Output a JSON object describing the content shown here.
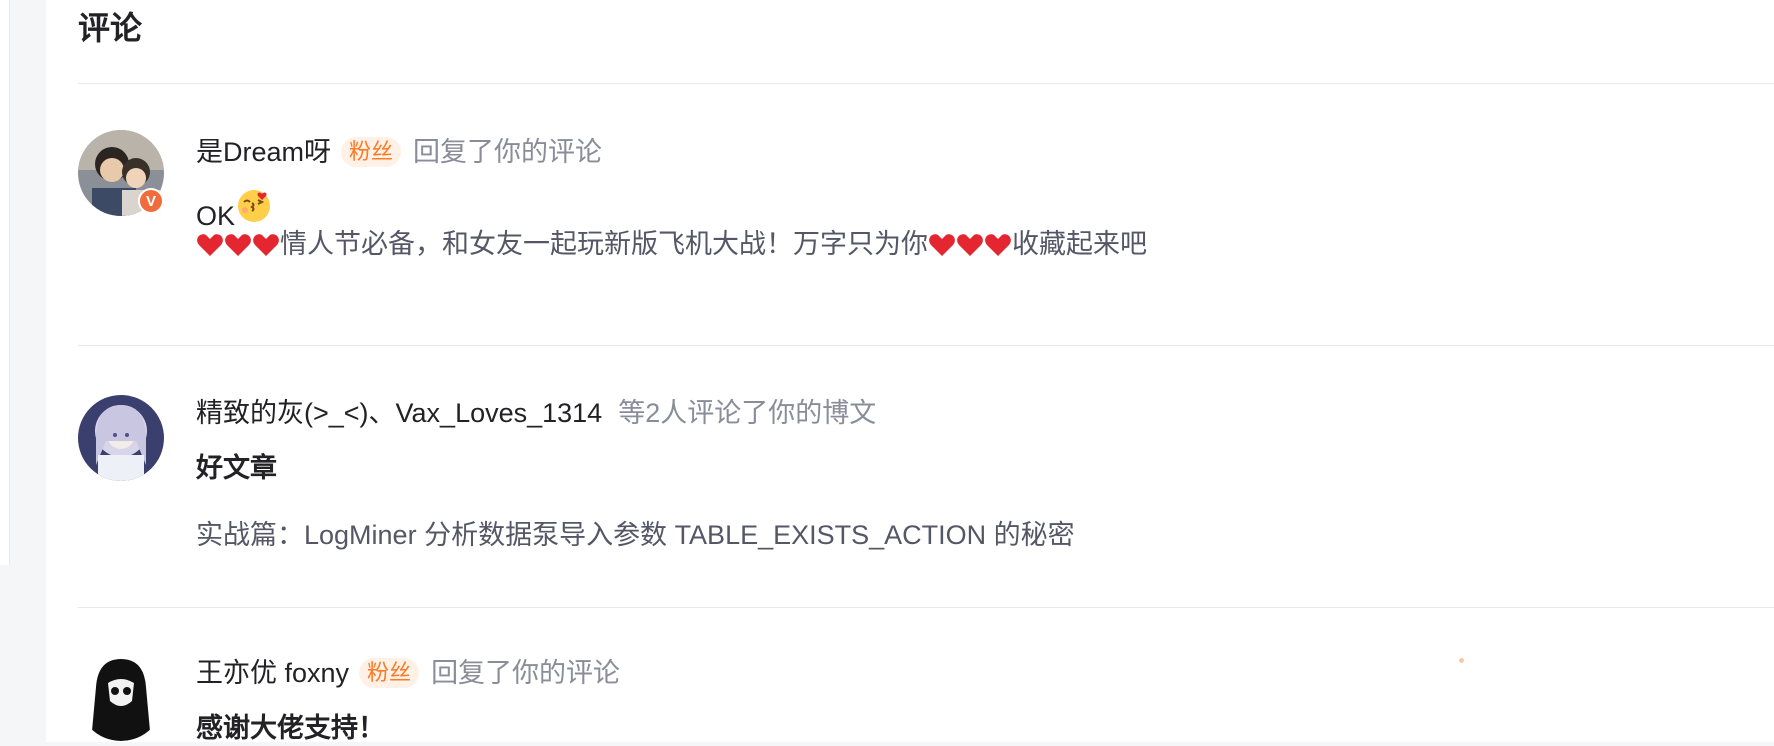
{
  "section": {
    "title": "评论"
  },
  "notifications": [
    {
      "username": "是Dream呀",
      "badge": "粉丝",
      "action": "回复了你的评论",
      "comment": "OK",
      "comment_emoji": "kiss-face-emoji",
      "article_title": "情人节必备，和女友一起玩新版飞机大战！万字只为你",
      "article_suffix": "收藏起来吧",
      "avatar_badge": "V"
    },
    {
      "username": "精致的灰(>_<)、Vax_Loves_1314",
      "action": "等2人评论了你的博文",
      "comment": "好文章",
      "article_title": "实战篇：LogMiner 分析数据泵导入参数 TABLE_EXISTS_ACTION 的秘密"
    },
    {
      "username": "王亦优 foxny",
      "badge": "粉丝",
      "action": "回复了你的评论",
      "comment": "感谢大佬支持！"
    }
  ],
  "colors": {
    "accent_orange": "#fc7a26",
    "badge_bg": "#fff1e6",
    "muted_text": "#8a8c99",
    "heart": "#e3262f"
  }
}
